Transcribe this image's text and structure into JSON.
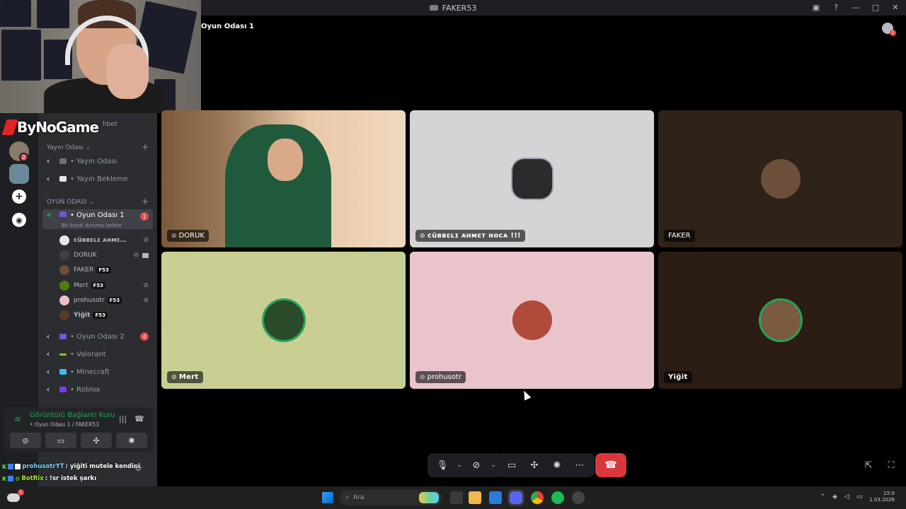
{
  "window": {
    "title": "FAKER53"
  },
  "channel_header": {
    "title": "Oyun Odası 1"
  },
  "overlay": {
    "logo_text": "ByNoGame",
    "partial_label": "hbet"
  },
  "rail": {
    "server_badge": "2"
  },
  "sidebar": {
    "category_yayin": "Yayın Odası",
    "yayin_channels": [
      {
        "label": "• Yayın Odası"
      },
      {
        "label": "• Yayın Bekleme"
      }
    ],
    "category_oyun": "OYUN ODASI",
    "active_channel": {
      "label": "• Oyun Odası 1",
      "count": "1",
      "status": "Bir kanal durumu belirle"
    },
    "members": [
      {
        "name": "ᴄüʙʙᴇʟɪ ᴀʜᴍᴇ…",
        "tag": ""
      },
      {
        "name": "DORUK",
        "tag": ""
      },
      {
        "name": "FAKER",
        "tag": "F53"
      },
      {
        "name": "Mert",
        "tag": "F53"
      },
      {
        "name": "prohusotr",
        "tag": "F53"
      },
      {
        "name": "Yiğit",
        "tag": "F53"
      }
    ],
    "other_channels": [
      {
        "label": "• Oyun Odası 2",
        "count": "4"
      },
      {
        "label": "• Valorant",
        "count": ""
      },
      {
        "label": "• Minecraft",
        "count": ""
      },
      {
        "label": "• Roblox",
        "count": ""
      }
    ]
  },
  "voice_panel": {
    "status": "Görüntülü Bağlantı Kuru",
    "sub": "• Oyun Odası 1 / FAKER53"
  },
  "chat": [
    {
      "user": "prohusotrYT",
      "text": ": yiğiti mutele kendini"
    },
    {
      "user": "BotRix",
      "text": ": !sr istek şarkı"
    }
  ],
  "tiles": [
    {
      "name": "DORUK",
      "bg": "#7a5a3a"
    },
    {
      "name": "ᴄüʙʙᴇʟɪ ᴀʜᴍᴇᴛ ʜᴏᴄᴀ !!!",
      "bg": "#d4d4d6"
    },
    {
      "name": "FAKER",
      "bg": "#2e2219"
    },
    {
      "name": "Mert",
      "bg": "#c9cf92"
    },
    {
      "name": "prohusotr",
      "bg": "#eac4cb"
    },
    {
      "name": "Yiğit",
      "bg": "#2c1d14"
    }
  ],
  "taskbar": {
    "search_placeholder": "Ara",
    "weather_badge": "1",
    "time": "15:0",
    "date": "1.03.2026"
  },
  "colors": {
    "accent_green": "#23a55a",
    "hangup_red": "#da373c",
    "badge_red": "#e5484d"
  }
}
